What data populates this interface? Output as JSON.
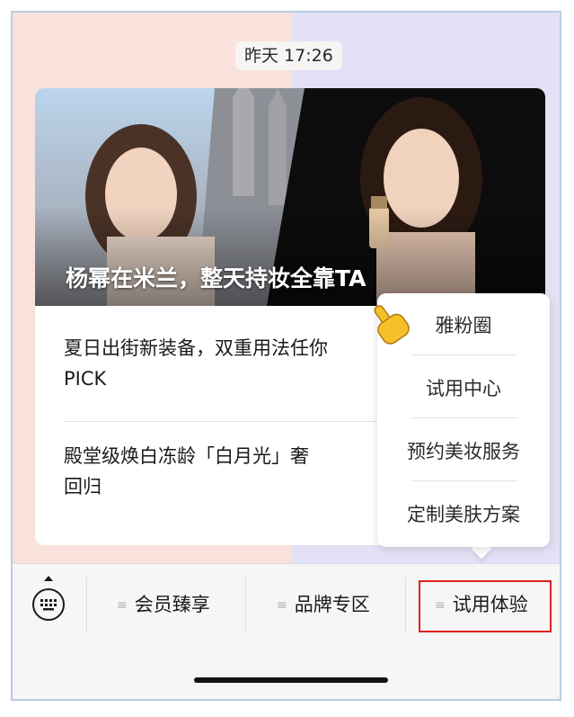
{
  "timestamp": "昨天 17:26",
  "hero": {
    "title": "杨幂在米兰，整天持妆全靠TA"
  },
  "articles": [
    {
      "line1": "夏日出街新装备，双重用法任你",
      "line2": "PICK"
    },
    {
      "line1": "殿堂级焕白冻龄「白月光」奢",
      "line2": "回归"
    }
  ],
  "popup_menu": [
    "雅粉圈",
    "试用中心",
    "预约美妆服务",
    "定制美肤方案"
  ],
  "tabbar": {
    "keyboard_icon": "keyboard-icon",
    "tabs": [
      "会员臻享",
      "品牌专区",
      "试用体验"
    ],
    "menu_icon_glyph": "≡"
  },
  "colors": {
    "highlight": "#e02020",
    "pointer": "#f5c02a"
  }
}
